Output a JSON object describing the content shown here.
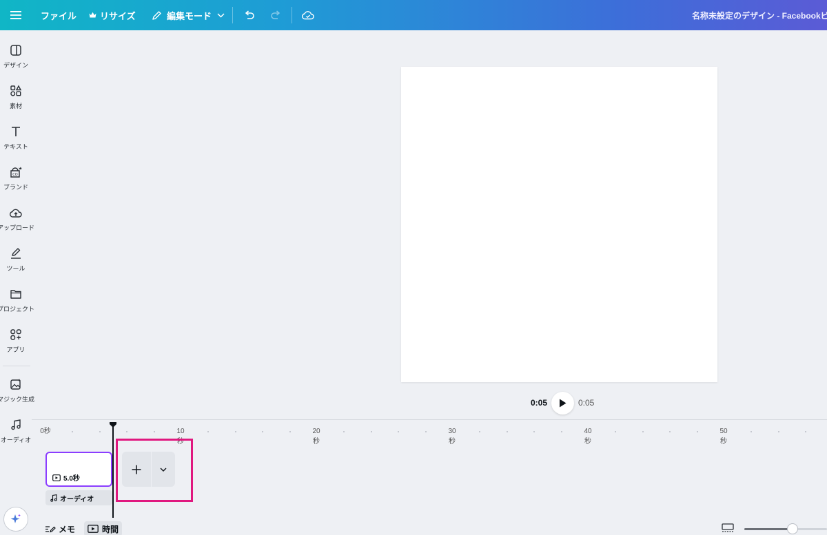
{
  "topbar": {
    "file_label": "ファイル",
    "resize_label": "リサイズ",
    "edit_mode_label": "編集モード",
    "design_title": "名称未設定のデザイン - Facebookビデオ"
  },
  "sidebar": {
    "items": [
      {
        "label": "デザイン",
        "icon": "layout-icon"
      },
      {
        "label": "素材",
        "icon": "shapes-icon"
      },
      {
        "label": "テキスト",
        "icon": "text-icon"
      },
      {
        "label": "ブランド",
        "icon": "brand-icon"
      },
      {
        "label": "アップロード",
        "icon": "upload-cloud-icon"
      },
      {
        "label": "ツール",
        "icon": "draw-tool-icon"
      },
      {
        "label": "プロジェクト",
        "icon": "folder-icon"
      },
      {
        "label": "アプリ",
        "icon": "apps-icon"
      },
      {
        "label": "マジック生成",
        "icon": "magic-image-icon"
      },
      {
        "label": "オーディオ",
        "icon": "music-note-icon"
      }
    ]
  },
  "playback": {
    "current_time": "0:05",
    "total_time": "0:05"
  },
  "timeline": {
    "ruler": {
      "zero_label": "0秒",
      "marks": [
        {
          "num": "10",
          "unit": "秒"
        },
        {
          "num": "20",
          "unit": "秒"
        },
        {
          "num": "30",
          "unit": "秒"
        },
        {
          "num": "40",
          "unit": "秒"
        },
        {
          "num": "50",
          "unit": "秒"
        }
      ]
    },
    "clip_duration": "5.0秒",
    "audio_label": "オーディオ",
    "zoom_level": 0.58
  },
  "bottom": {
    "notes_label": "メモ",
    "time_label": "時間"
  },
  "colors": {
    "accent": "#8b3dff",
    "highlight": "#e0187f",
    "topbar_start": "#10b6c6",
    "topbar_end": "#5b5bd6"
  }
}
